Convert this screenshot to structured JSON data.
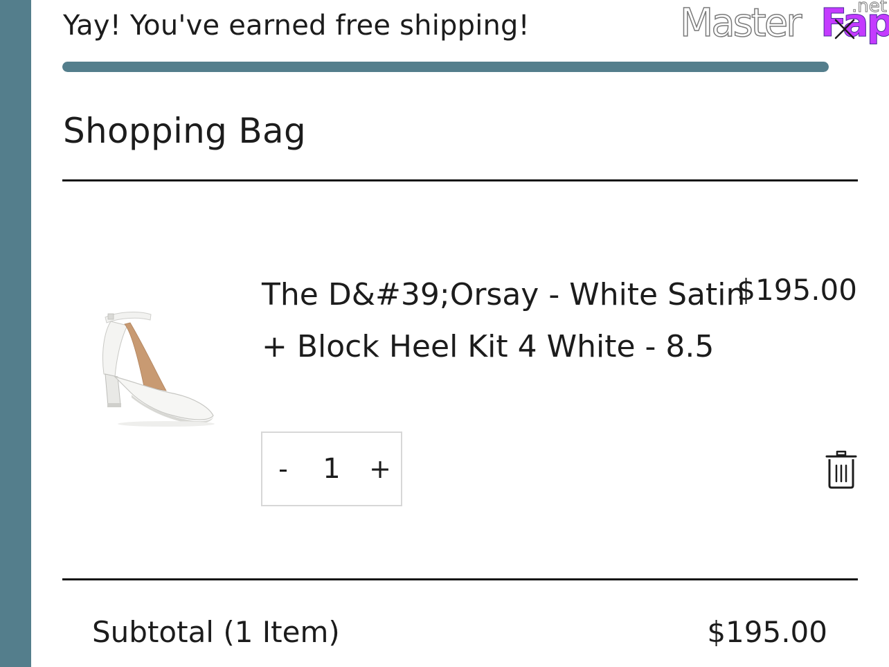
{
  "colors": {
    "accent": "#547e8c",
    "text": "#1c1c1c",
    "divider": "#111111",
    "qty_border": "#d7d7d7"
  },
  "shipping": {
    "message": "Yay! You've earned free shipping!",
    "progress": 1.0
  },
  "watermark": {
    "main": "Master",
    "accent": "Fap",
    "tld": ".net"
  },
  "header": {
    "title": "Shopping Bag",
    "close_icon": "close-icon"
  },
  "cart": {
    "items": [
      {
        "name": "The D&#39;Orsay - White Satin + Block Heel Kit 4 White - 8.5",
        "price": "$195.00",
        "quantity": "1",
        "decrement_label": "-",
        "increment_label": "+",
        "image_icon": "white-pointed-toe-block-heel-pump",
        "remove_icon": "trash-icon"
      }
    ]
  },
  "summary": {
    "subtotal_label": "Subtotal (1 Item)",
    "subtotal_value": "$195.00"
  }
}
